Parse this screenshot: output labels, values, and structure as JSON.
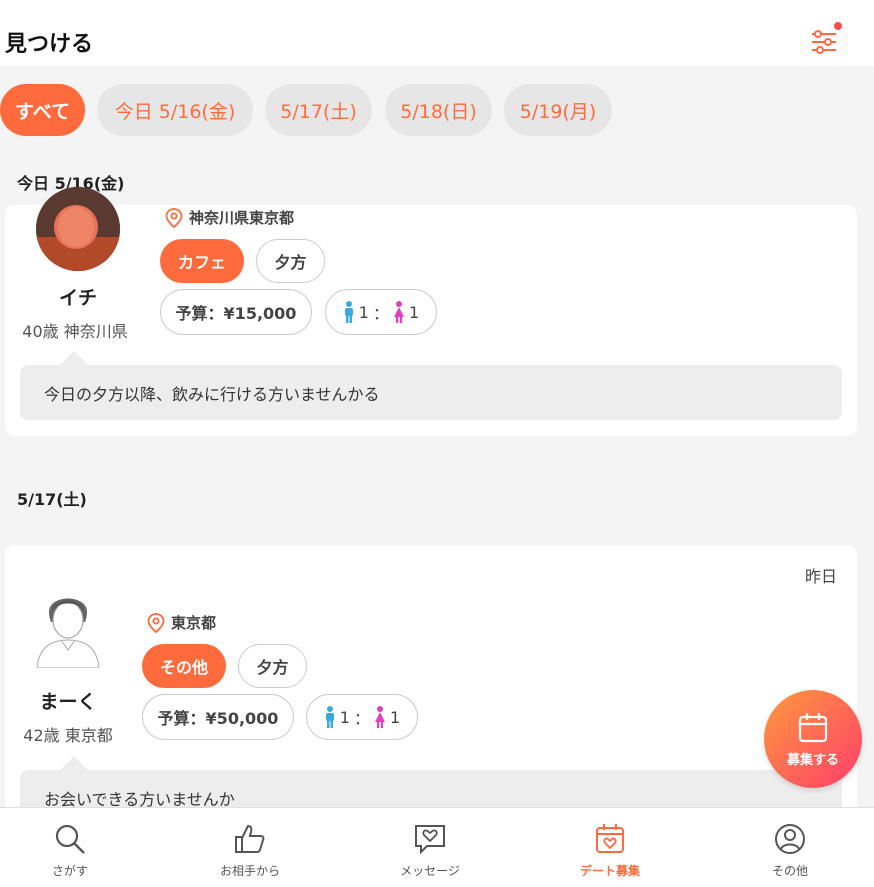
{
  "header": {
    "title": "見つける"
  },
  "chips": [
    {
      "label": "すべて",
      "active": true
    },
    {
      "label": "今日 5/16(金)",
      "active": false
    },
    {
      "label": "5/17(土)",
      "active": false
    },
    {
      "label": "5/18(日)",
      "active": false
    },
    {
      "label": "5/19(月)",
      "active": false
    }
  ],
  "sections": [
    {
      "label": "今日 5/16(金)",
      "posts": [
        {
          "name": "イチ",
          "meta": "40歳 神奈川県",
          "location": "神奈川県東京都",
          "category": "カフェ",
          "time": "夕方",
          "budget": "予算：¥15,000",
          "ratio": {
            "male": "1",
            "sep": "：",
            "female": "1"
          },
          "message": "今日の夕方以降、飲みに行ける方いませんかる"
        }
      ]
    },
    {
      "label": "5/17(土)",
      "posts": [
        {
          "posted": "昨日",
          "name": "まーく",
          "meta": "42歳 東京都",
          "location": "東京都",
          "category": "その他",
          "time": "夕方",
          "budget": "予算：¥50,000",
          "ratio": {
            "male": "1",
            "sep": "：",
            "female": "1"
          },
          "message": "お会いできる方いませんか"
        }
      ]
    }
  ],
  "fab": {
    "label": "募集する",
    "icon": "calendar-icon"
  },
  "tabbar": [
    {
      "label": "さがす",
      "icon": "search-icon"
    },
    {
      "label": "お相手から",
      "icon": "thumbs-up-icon"
    },
    {
      "label": "メッセージ",
      "icon": "message-heart-icon"
    },
    {
      "label": "デート募集",
      "icon": "calendar-heart-icon",
      "active": true
    },
    {
      "label": "その他",
      "icon": "user-icon"
    }
  ],
  "colors": {
    "accent": "#ff6b3d",
    "male": "#3aa9e0",
    "female": "#e040c0"
  }
}
